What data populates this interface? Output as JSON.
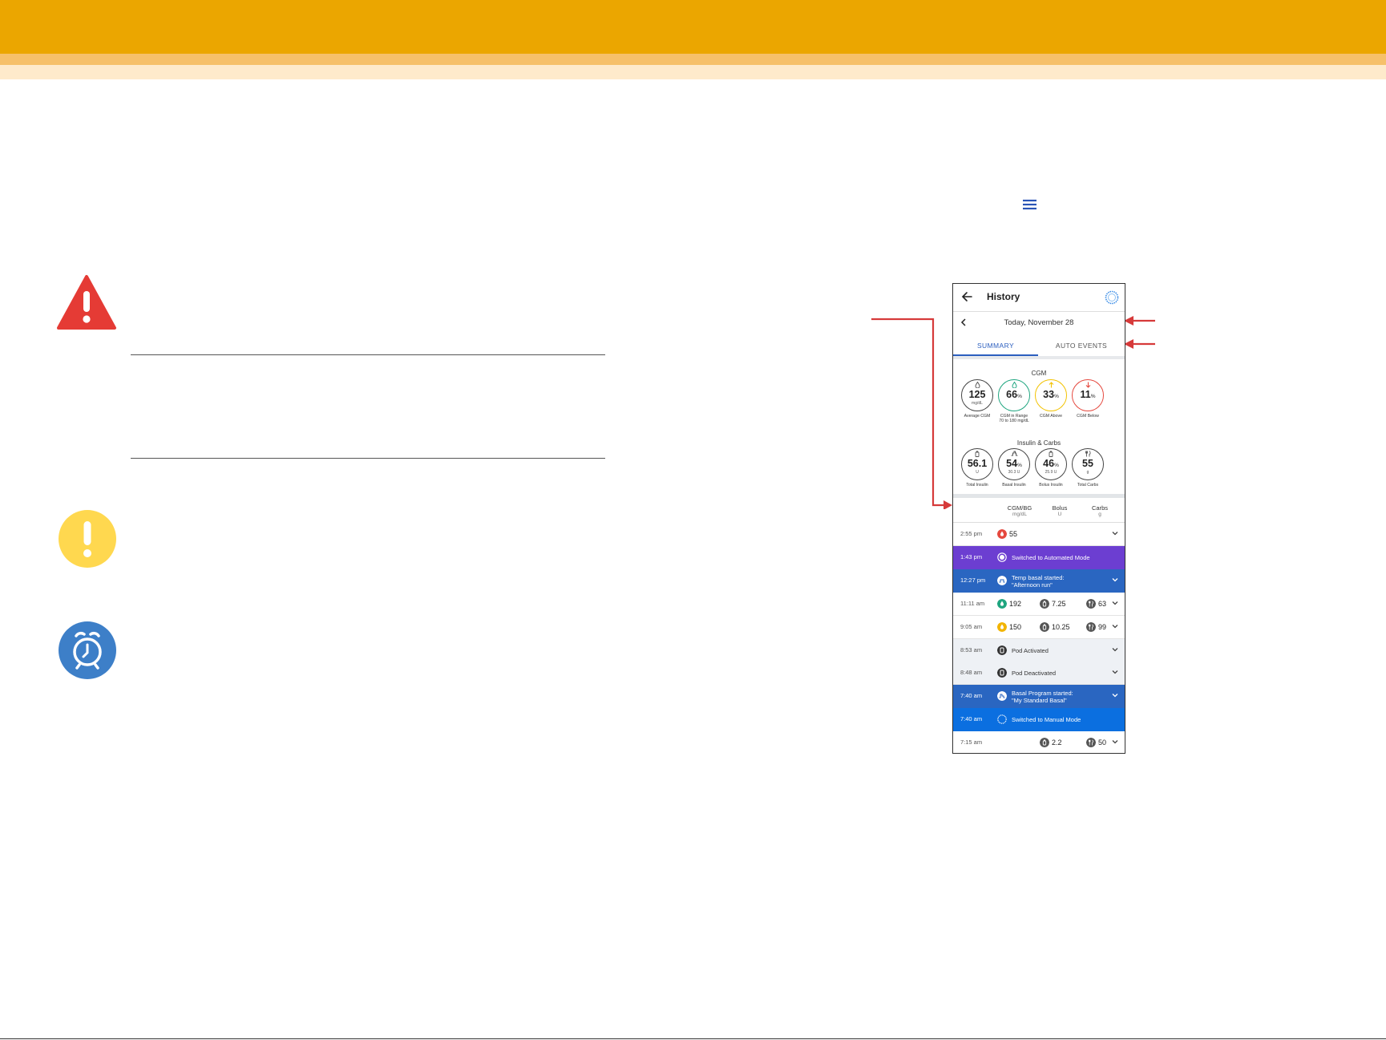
{
  "colors": {
    "brand_orange": "#EBA600",
    "band_peach": "#F6C06A",
    "band_cream": "#FEEACB",
    "warning_red": "#E53B35",
    "caution_yellow": "#FFD84F",
    "reminder_blue": "#3D7FC8",
    "annotation_red": "#D63A3A",
    "automated_mode_purple": "#6C3ED1",
    "event_blue": "#2A66C1",
    "manual_mode_blue": "#0B6FE0",
    "tab_blue": "#2C5FBF"
  },
  "icons": {
    "warning": "warning-triangle-icon",
    "caution": "exclamation-circle-icon",
    "reminder": "alarm-clock-icon",
    "menu": "hamburger-menu-icon"
  },
  "phone": {
    "title": "History",
    "date": "Today, November 28",
    "tabs": [
      "SUMMARY",
      "AUTO EVENTS"
    ],
    "cgm_section": {
      "title": "CGM",
      "gauges": [
        {
          "value": "125",
          "suffix": "",
          "unit": "mg/dL",
          "label": "Average CGM",
          "color": "#444444",
          "icon": "drop-icon"
        },
        {
          "value": "66",
          "suffix": "%",
          "unit": "",
          "label": "CGM in Range\n70 to 180 mg/dL",
          "color": "#1EA57F",
          "icon": "drop-icon"
        },
        {
          "value": "33",
          "suffix": "%",
          "unit": "",
          "label": "CGM Above",
          "color": "#F2C200",
          "icon": "arrow-up-icon"
        },
        {
          "value": "11",
          "suffix": "%",
          "unit": "",
          "label": "CGM Below",
          "color": "#E5483E",
          "icon": "arrow-down-icon"
        }
      ]
    },
    "insulin_section": {
      "title": "Insulin & Carbs",
      "gauges": [
        {
          "value": "56.1",
          "suffix": "",
          "unit": "U",
          "label": "Total Insulin",
          "color": "#444444",
          "icon": "vial-icon"
        },
        {
          "value": "54",
          "suffix": "%",
          "unit": "30.3 U",
          "label": "Basal Insulin",
          "color": "#444444",
          "icon": "basal-icon"
        },
        {
          "value": "46",
          "suffix": "%",
          "unit": "25.9 U",
          "label": "Bolus Insulin",
          "color": "#444444",
          "icon": "vial-icon"
        },
        {
          "value": "55",
          "suffix": "",
          "unit": "g",
          "label": "Total Carbs",
          "color": "#444444",
          "icon": "fork-knife-icon"
        }
      ]
    },
    "columns": [
      {
        "label": "CGM/BG",
        "unit": "mg/dL"
      },
      {
        "label": "Bolus",
        "unit": "U"
      },
      {
        "label": "Carbs",
        "unit": "g"
      }
    ],
    "rows": [
      {
        "time": "2:55 pm",
        "type": "data",
        "cgm": "55",
        "cgm_color": "#E5483E",
        "bolus": "",
        "carbs": "",
        "expand": true
      },
      {
        "time": "1:43 pm",
        "type": "event",
        "bg": "#6C3ED1",
        "text": "Switched to Automated Mode",
        "icon": "automated-mode-icon",
        "expand": false
      },
      {
        "time": "12:27 pm",
        "type": "event",
        "bg": "#2A66C1",
        "text": "Temp basal started:\n\"Afternoon run\"",
        "icon": "temp-basal-icon",
        "expand": true
      },
      {
        "time": "11:11 am",
        "type": "data",
        "cgm": "192",
        "cgm_color": "#1EA57F",
        "bolus": "7.25",
        "carbs": "63",
        "expand": true
      },
      {
        "time": "9:05 am",
        "type": "data",
        "cgm": "150",
        "cgm_color": "#F2B400",
        "bolus": "10.25",
        "carbs": "99",
        "expand": true
      },
      {
        "time": "8:53 am",
        "type": "light",
        "text": "Pod Activated",
        "icon": "pod-icon",
        "expand": true
      },
      {
        "time": "8:48 am",
        "type": "light",
        "text": "Pod Deactivated",
        "icon": "pod-icon",
        "expand": true
      },
      {
        "time": "7:40 am",
        "type": "event",
        "bg": "#2A66C1",
        "text": "Basal Program started:\n\"My Standard Basal\"",
        "icon": "basal-program-icon",
        "expand": true
      },
      {
        "time": "7:40 am",
        "type": "event",
        "bg": "#0B6FE0",
        "text": "Switched to Manual Mode",
        "icon": "manual-mode-icon",
        "expand": false
      },
      {
        "time": "7:15 am",
        "type": "data",
        "cgm": "",
        "cgm_color": "",
        "bolus": "2.2",
        "carbs": "50",
        "expand": true
      }
    ]
  }
}
